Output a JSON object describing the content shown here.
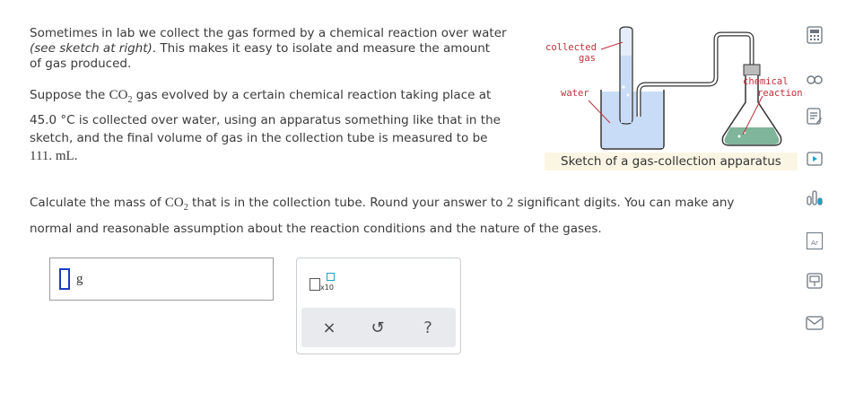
{
  "intro": {
    "line1": "Sometimes in lab we collect the gas formed by a chemical reaction over water",
    "line2_italic": "(see sketch at right)",
    "line2_rest": ". This makes it easy to isolate and measure the amount",
    "line3": "of gas produced."
  },
  "problem": {
    "suppose_prefix": "Suppose the",
    "co2_base": "CO",
    "co2_sub": "2",
    "suppose_suffix": "gas evolved by a certain chemical reaction taking place at",
    "temperature": "45.0 °C",
    "line2_rest": "is collected over water, using an apparatus something like that in the",
    "line3": "sketch, and the final volume of gas in the collection tube is measured to be",
    "volume": "111. mL."
  },
  "sketch": {
    "label_collected": "collected",
    "label_gas": "gas",
    "label_water": "water",
    "label_chemical": "chemical",
    "label_reaction": "reaction",
    "caption": "Sketch of a gas-collection apparatus",
    "colors": {
      "water": "#c9dcf7",
      "reaction": "#7fb59a",
      "arrow": "#c0303a"
    }
  },
  "question": {
    "line1_prefix": "Calculate the mass of",
    "co2_base": "CO",
    "co2_sub": "2",
    "line1_mid": "that is in the collection tube. Round your answer to",
    "digits": "2",
    "line1_suffix": "significant digits. You can make any",
    "line2": "normal and reasonable assumption about the reaction conditions and the nature of the gases."
  },
  "answer": {
    "unit": "g"
  },
  "keypad": {
    "x10_label": "x10",
    "clear_symbol": "×",
    "undo_symbol": "↺",
    "help_symbol": "?"
  },
  "sidebar": {
    "icons": [
      "calculator-icon",
      "link-icon",
      "notes-icon",
      "video-icon",
      "data-icon",
      "periodic-table-icon",
      "textbook-icon",
      "message-icon"
    ],
    "periodic_label": "Ar"
  }
}
